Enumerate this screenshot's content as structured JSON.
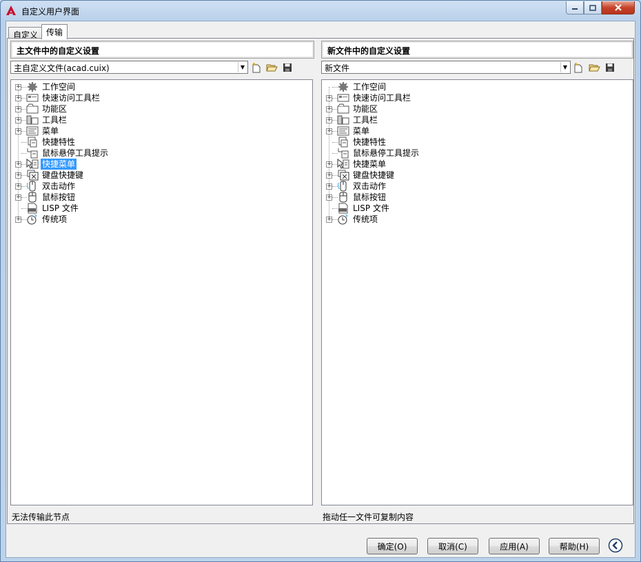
{
  "window": {
    "title": "自定义用户界面"
  },
  "tabs": [
    {
      "label": "自定义"
    },
    {
      "label": "传输"
    }
  ],
  "left_panel": {
    "header": "主文件中的自定义设置",
    "combo_value": "主自定义文件(acad.cuix)",
    "status": "无法传输此节点",
    "tree": [
      {
        "label": "工作空间",
        "icon": "workspace-icon",
        "expandable": true
      },
      {
        "label": "快速访问工具栏",
        "icon": "quick-access-toolbar-icon",
        "expandable": true
      },
      {
        "label": "功能区",
        "icon": "ribbon-icon",
        "expandable": true
      },
      {
        "label": "工具栏",
        "icon": "toolbar-icon",
        "expandable": true
      },
      {
        "label": "菜单",
        "icon": "menu-icon",
        "expandable": true
      },
      {
        "label": "快捷特性",
        "icon": "quick-properties-icon",
        "expandable": false
      },
      {
        "label": "鼠标悬停工具提示",
        "icon": "rollover-tooltip-icon",
        "expandable": false
      },
      {
        "label": "快捷菜单",
        "icon": "shortcut-menu-icon",
        "expandable": true,
        "selected": true
      },
      {
        "label": "键盘快捷键",
        "icon": "keyboard-shortcut-icon",
        "expandable": true
      },
      {
        "label": "双击动作",
        "icon": "double-click-icon",
        "expandable": true
      },
      {
        "label": "鼠标按钮",
        "icon": "mouse-button-icon",
        "expandable": true
      },
      {
        "label": "LISP 文件",
        "icon": "lisp-file-icon",
        "expandable": false
      },
      {
        "label": "传统项",
        "icon": "legacy-icon",
        "expandable": true
      }
    ]
  },
  "right_panel": {
    "header": "新文件中的自定义设置",
    "combo_value": "新文件",
    "status": "拖动任一文件可复制内容",
    "tree": [
      {
        "label": "工作空间",
        "icon": "workspace-icon",
        "expandable": false
      },
      {
        "label": "快速访问工具栏",
        "icon": "quick-access-toolbar-icon",
        "expandable": true
      },
      {
        "label": "功能区",
        "icon": "ribbon-icon",
        "expandable": true
      },
      {
        "label": "工具栏",
        "icon": "toolbar-icon",
        "expandable": true
      },
      {
        "label": "菜单",
        "icon": "menu-icon",
        "expandable": true
      },
      {
        "label": "快捷特性",
        "icon": "quick-properties-icon",
        "expandable": false
      },
      {
        "label": "鼠标悬停工具提示",
        "icon": "rollover-tooltip-icon",
        "expandable": false
      },
      {
        "label": "快捷菜单",
        "icon": "shortcut-menu-icon",
        "expandable": true
      },
      {
        "label": "键盘快捷键",
        "icon": "keyboard-shortcut-icon",
        "expandable": true
      },
      {
        "label": "双击动作",
        "icon": "double-click-icon",
        "expandable": true
      },
      {
        "label": "鼠标按钮",
        "icon": "mouse-button-icon",
        "expandable": true
      },
      {
        "label": "LISP 文件",
        "icon": "lisp-file-icon",
        "expandable": false
      },
      {
        "label": "传统项",
        "icon": "legacy-icon",
        "expandable": true
      }
    ]
  },
  "buttons": {
    "ok": "确定(O)",
    "cancel": "取消(C)",
    "apply": "应用(A)",
    "help": "帮助(H)"
  },
  "colors": {
    "selection": "#3399ff",
    "title_bar": "#bcd3ea",
    "close_button": "#c7432b"
  }
}
